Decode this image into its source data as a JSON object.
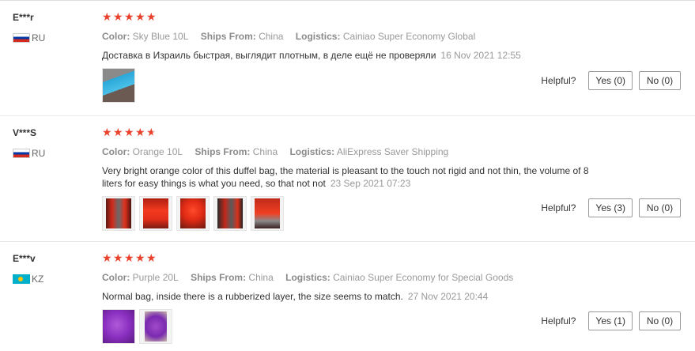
{
  "labels": {
    "color": "Color:",
    "ships_from": "Ships From:",
    "logistics": "Logistics:",
    "helpful": "Helpful?"
  },
  "colors": {
    "star": "#e9412b",
    "label": "#8a8a8a",
    "muted": "#999999"
  },
  "reviews": [
    {
      "buyer": "E***r",
      "country_code": "RU",
      "flag": "russia-flag",
      "rating": 5,
      "color": "Sky Blue 10L",
      "ships_from": "China",
      "logistics": "Cainiao Super Economy Global",
      "text": "Доставка в Израиль быстрая, выглядит плотным, в деле ещё не проверяли",
      "date": "16 Nov 2021 12:55",
      "photo_count": 1,
      "yes": "Yes (0)",
      "no": "No (0)"
    },
    {
      "buyer": "V***S",
      "country_code": "RU",
      "flag": "russia-flag",
      "rating": 4.5,
      "color": "Orange 10L",
      "ships_from": "China",
      "logistics": "AliExpress Saver Shipping",
      "text": "Very bright orange color of this duffel bag, the material is pleasant to the touch not rigid and not thin, the volume of 8 liters for easy things is what you need, so that not not",
      "date": "23 Sep 2021 07:23",
      "photo_count": 5,
      "yes": "Yes (3)",
      "no": "No (0)"
    },
    {
      "buyer": "E***v",
      "country_code": "KZ",
      "flag": "kazakhstan-flag",
      "rating": 5,
      "color": "Purple 20L",
      "ships_from": "China",
      "logistics": "Cainiao Super Economy for Special Goods",
      "text": "Normal bag, inside there is a rubberized layer, the size seems to match.",
      "date": "27 Nov 2021 20:44",
      "photo_count": 2,
      "yes": "Yes (1)",
      "no": "No (0)"
    }
  ]
}
